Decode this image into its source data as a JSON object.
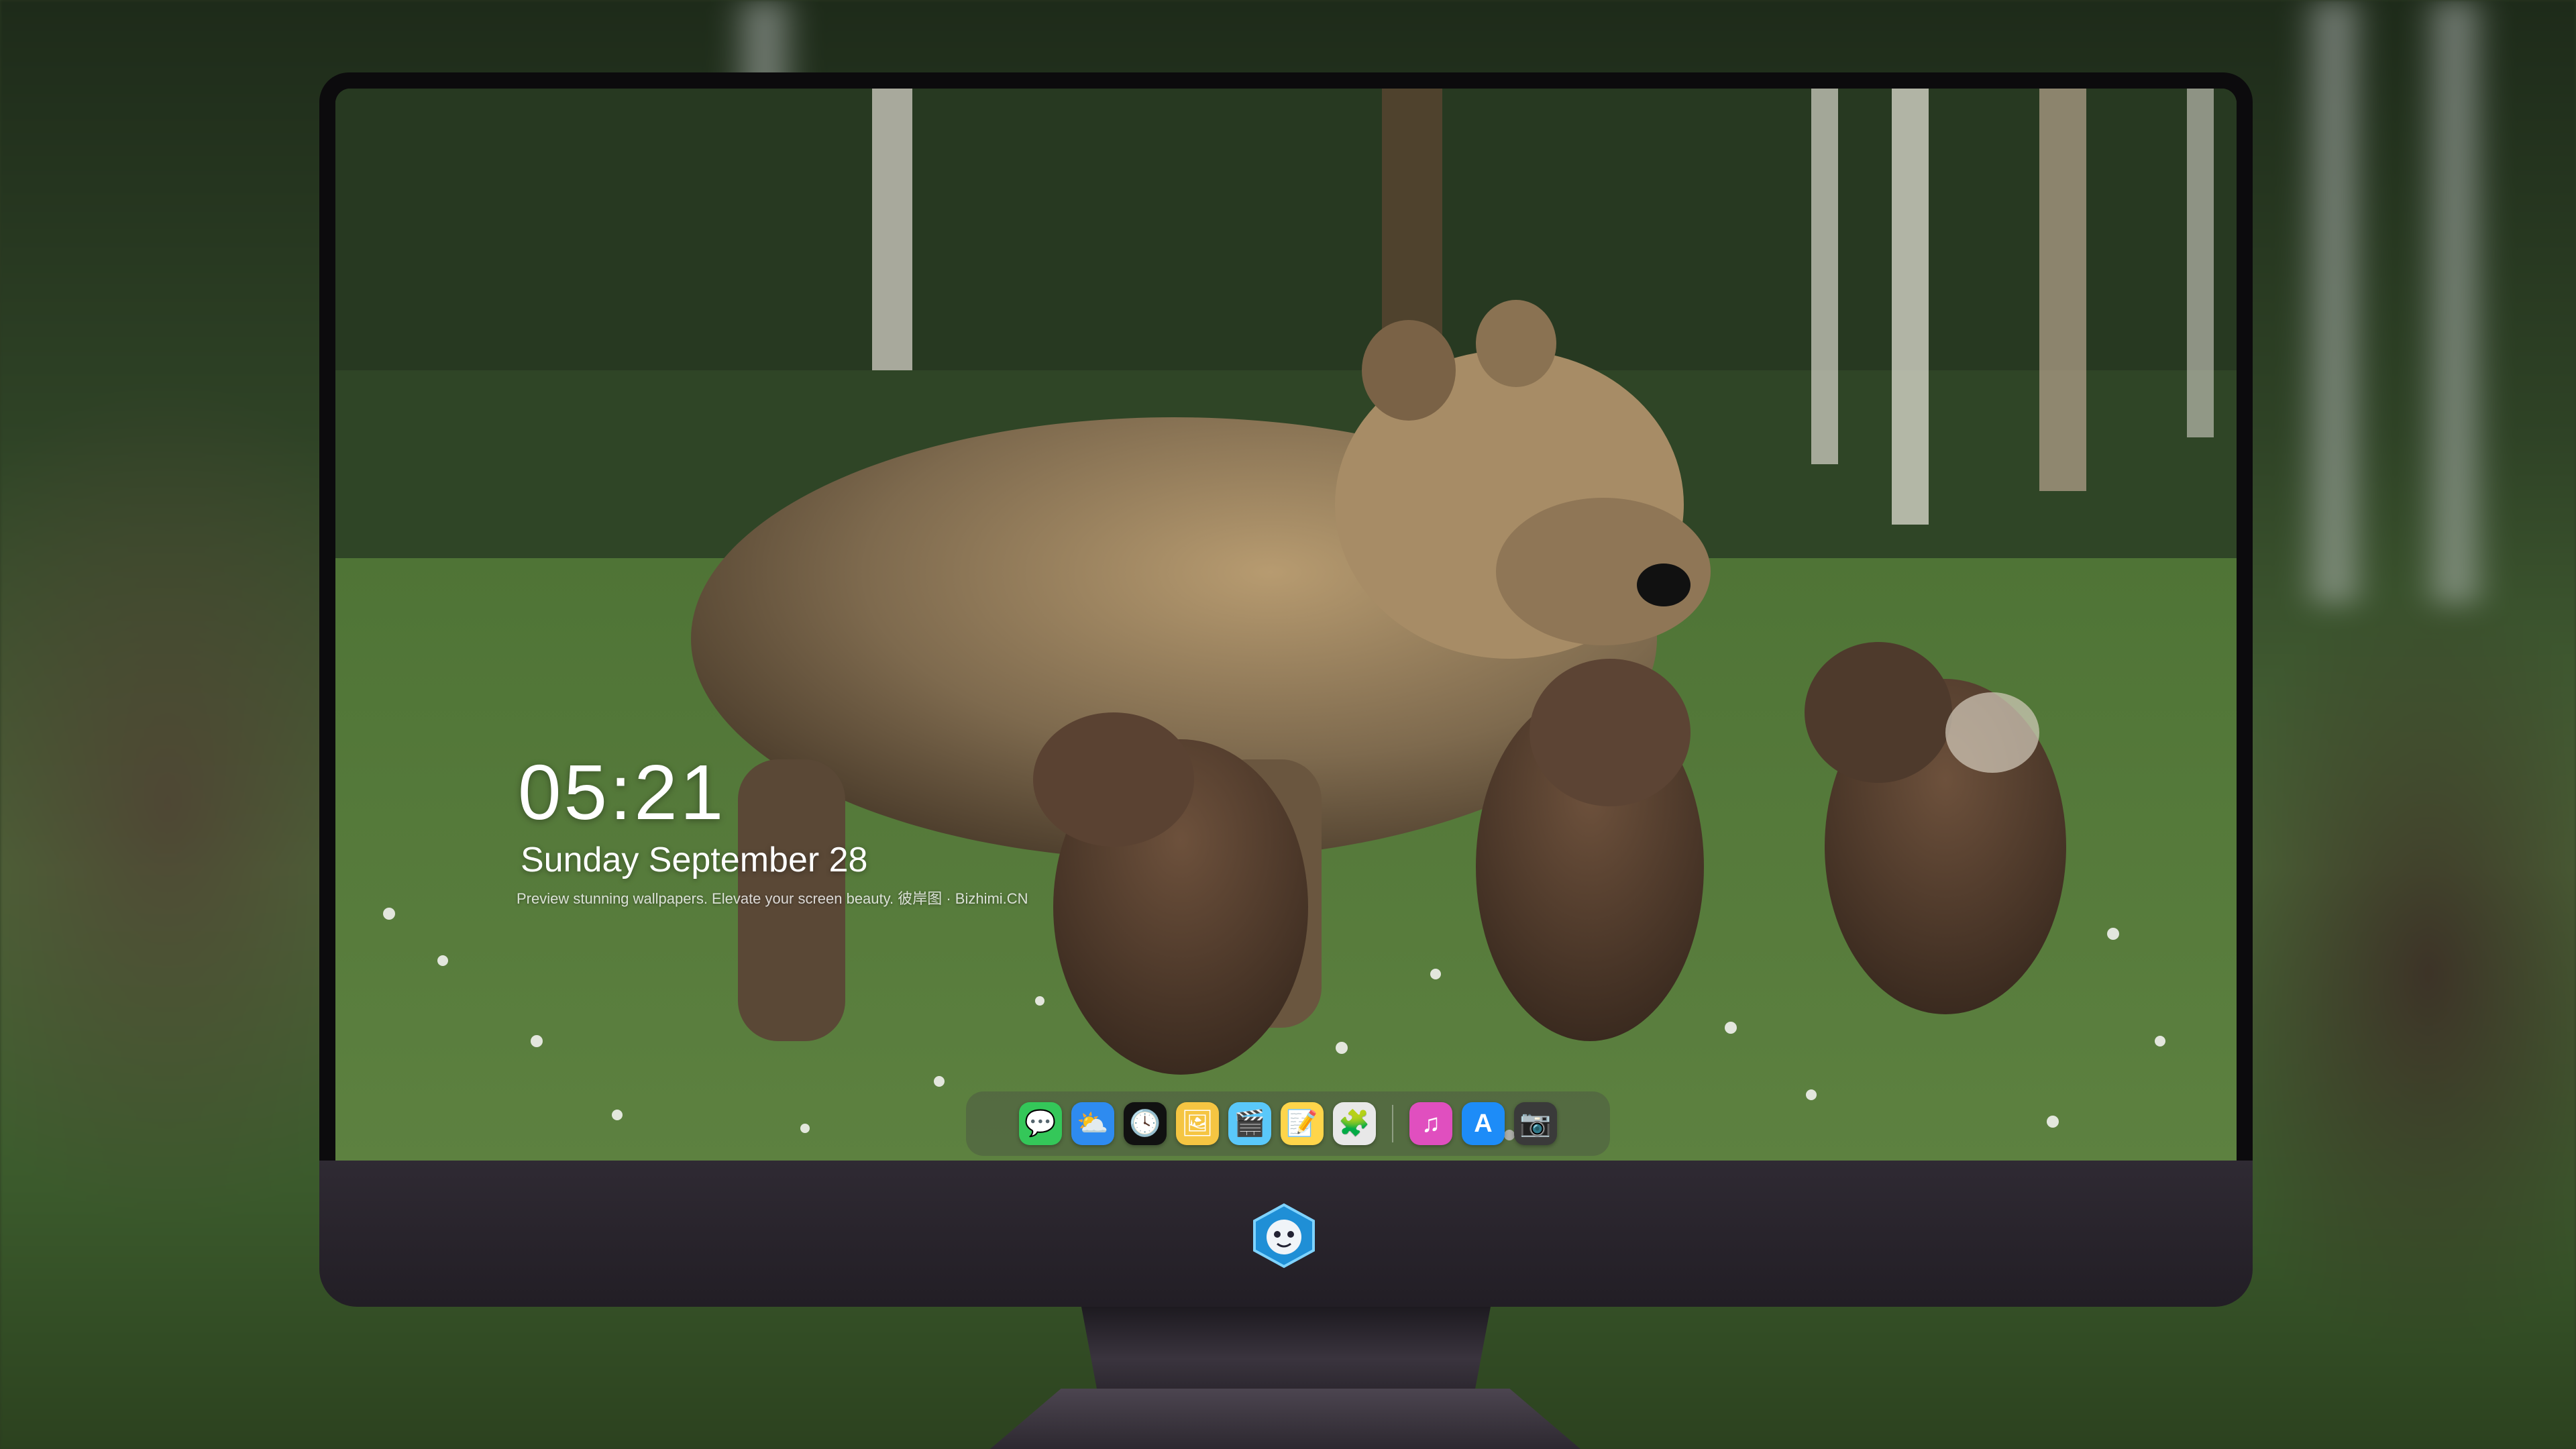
{
  "lock_screen": {
    "time": "05:21",
    "date": "Sunday September  28",
    "caption": "Preview stunning wallpapers. Elevate your screen beauty. 彼岸图 · Bizhimi.CN"
  },
  "dock": {
    "apps": [
      {
        "name": "messages",
        "glyph": "💬",
        "color": "#34c759"
      },
      {
        "name": "weather",
        "glyph": "⛅",
        "color": "#2e8bf0"
      },
      {
        "name": "clock",
        "glyph": "🕓",
        "color": "#111111"
      },
      {
        "name": "preview",
        "glyph": "🖼",
        "color": "#f5c542"
      },
      {
        "name": "clips",
        "glyph": "🎬",
        "color": "#5ac8fa"
      },
      {
        "name": "notes",
        "glyph": "📝",
        "color": "#ffd54a"
      },
      {
        "name": "photo-booth",
        "glyph": "🧩",
        "color": "#e8e8e8"
      },
      {
        "name": "itunes",
        "glyph": "♫",
        "color": "#e04fbf"
      },
      {
        "name": "app-store",
        "glyph": "A",
        "color": "#1d8cf8"
      },
      {
        "name": "camera",
        "glyph": "📷",
        "color": "#3a3a3a"
      }
    ]
  },
  "colors": {
    "bezel": "#0c0b0d",
    "chin": "#2a252e",
    "accent": "#34c759"
  }
}
